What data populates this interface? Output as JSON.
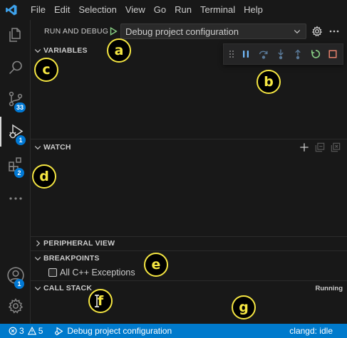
{
  "menu": {
    "items": [
      "File",
      "Edit",
      "Selection",
      "View",
      "Go",
      "Run",
      "Terminal",
      "Help"
    ]
  },
  "activity_bar": {
    "items": [
      {
        "icon": "explorer-icon"
      },
      {
        "icon": "search-icon"
      },
      {
        "icon": "source-control-icon",
        "badge": "33"
      },
      {
        "icon": "run-debug-icon",
        "badge": "1"
      },
      {
        "icon": "extensions-icon",
        "badge": "2"
      },
      {
        "icon": "more-icon"
      }
    ],
    "account_badge": "1"
  },
  "run_debug": {
    "title": "RUN AND DEBUG",
    "configuration": "Debug project configuration"
  },
  "sections": {
    "variables": "VARIABLES",
    "watch": "WATCH",
    "peripheral_view": "PERIPHERAL VIEW",
    "breakpoints": "BREAKPOINTS",
    "call_stack": "CALL STACK"
  },
  "breakpoints": {
    "items": [
      {
        "label": "All C++ Exceptions",
        "checked": false
      }
    ]
  },
  "call_stack": {
    "status": "Running"
  },
  "callouts": [
    "a",
    "b",
    "c",
    "d",
    "e",
    "f",
    "g"
  ],
  "status_bar": {
    "errors": "3",
    "warnings": "5",
    "launch_config": "Debug project configuration",
    "language_server": "clangd: idle"
  },
  "colors": {
    "accent": "#007acc",
    "callout": "#f5e642",
    "play_green": "#89d185",
    "stop_red": "#f48771",
    "step_blue": "#75beff"
  }
}
